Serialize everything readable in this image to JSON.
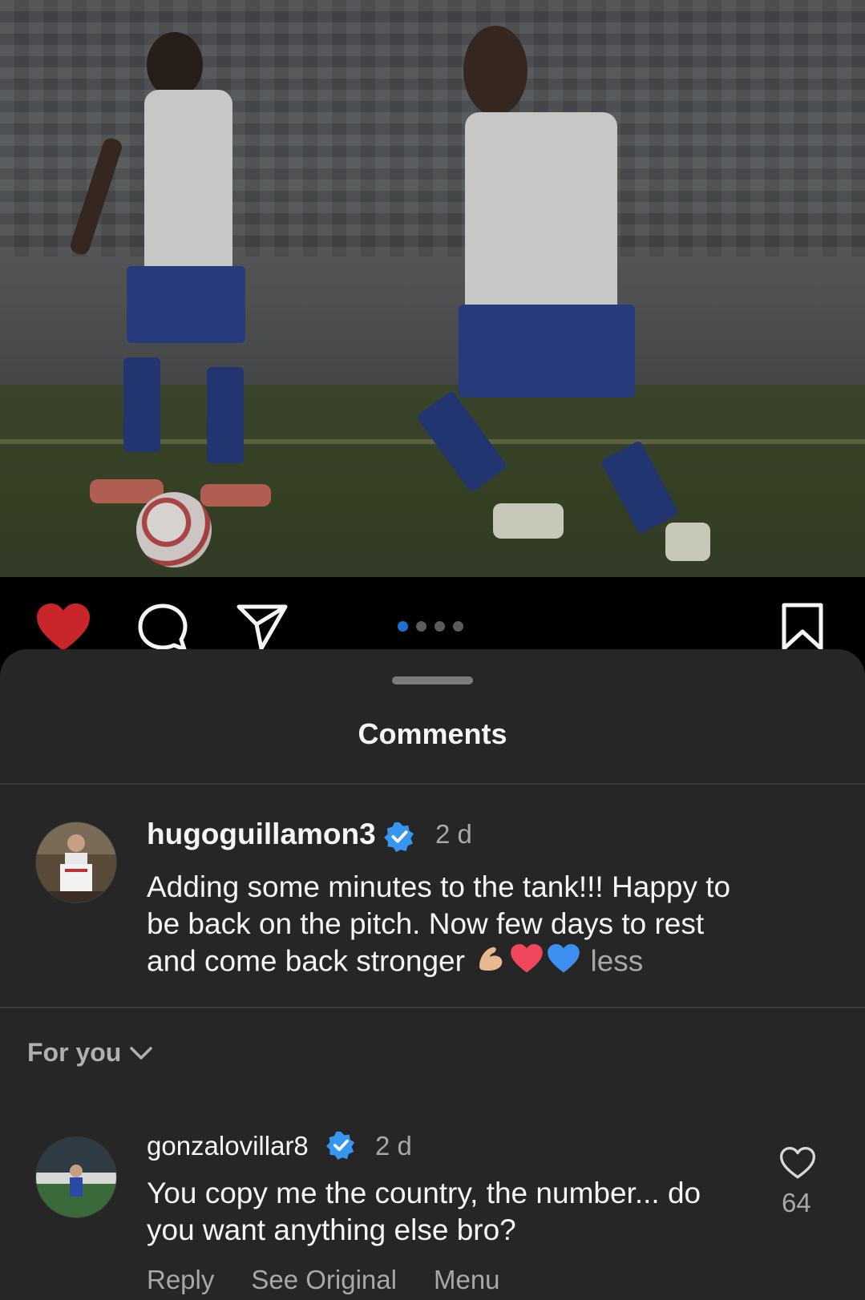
{
  "post": {
    "carousel": {
      "total_slides": 4,
      "current_slide": 1
    },
    "actions": {
      "like_icon": "heart-filled-icon",
      "comment_icon": "comment-bubble-icon",
      "share_icon": "paper-plane-icon",
      "save_icon": "bookmark-icon",
      "like_color": "#c9262b"
    }
  },
  "sheet": {
    "title": "Comments"
  },
  "caption": {
    "username": "hugoguillamon3",
    "verified": true,
    "time": "2 d",
    "text": "Adding some minutes to the tank!!! Happy to be back on the pitch. Now few days to rest and come back stronger",
    "emojis": [
      "flexed-biceps",
      "red-heart",
      "blue-heart"
    ],
    "less_label": "less"
  },
  "filter": {
    "label": "For you",
    "icon": "chevron-down-icon"
  },
  "comments": [
    {
      "username": "gonzalovillar8",
      "verified": true,
      "time": "2 d",
      "text": "You copy me the country, the number... do you want anything else bro?",
      "likes": "64",
      "reply_label": "Reply",
      "see_original_label": "See Original",
      "menu_label": "Menu"
    }
  ],
  "colors": {
    "sheet_bg": "#262626",
    "verified_blue": "#3797f0",
    "muted_text": "#a8a8a8"
  }
}
